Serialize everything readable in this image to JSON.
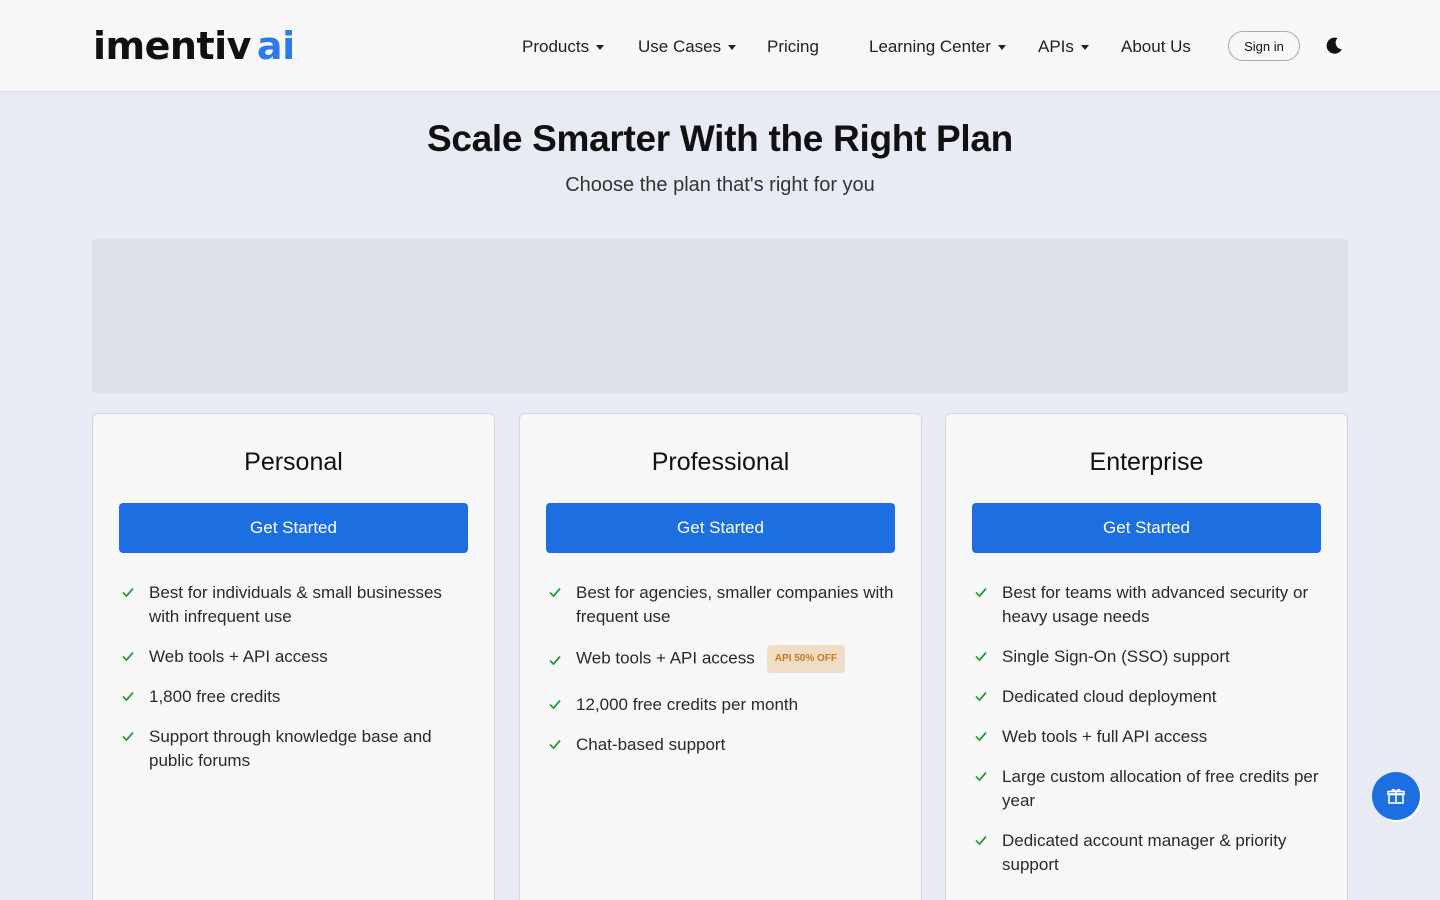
{
  "brand": {
    "name": "imentiv",
    "suffix": "ai"
  },
  "nav": {
    "products": "Products",
    "use_cases": "Use Cases",
    "pricing": "Pricing",
    "learning_center": "Learning Center",
    "apis": "APIs",
    "about": "About Us",
    "sign_in": "Sign in"
  },
  "hero": {
    "title": "Scale Smarter With the Right Plan",
    "subtitle": "Choose the plan that's right for you"
  },
  "plans": [
    {
      "name": "Personal",
      "cta": "Get Started",
      "features": [
        "Best for individuals & small businesses with infrequent use",
        "Web tools + API access",
        "1,800 free credits",
        "Support through knowledge base and public forums"
      ]
    },
    {
      "name": "Professional",
      "cta": "Get Started",
      "features": [
        "Best for agencies, smaller companies with frequent use",
        "Web tools + API access",
        "12,000 free credits per month",
        "Chat-based support"
      ],
      "badge": "API 50% OFF"
    },
    {
      "name": "Enterprise",
      "cta": "Get Started",
      "features": [
        "Best for teams with advanced security or heavy usage needs",
        "Single Sign-On (SSO) support",
        "Dedicated cloud deployment",
        "Web tools + full API access",
        "Large custom allocation of free credits per year",
        "Dedicated account manager & priority support"
      ]
    }
  ],
  "icons": {
    "theme_toggle": "moon-icon",
    "check": "check-icon",
    "floating": "gift-icon"
  },
  "colors": {
    "primary": "#1c6fe0",
    "brand_ai": "#2f7ae5",
    "check": "#2e9a3e",
    "badge_bg": "#f1dcc6",
    "badge_text": "#c47a1c"
  }
}
